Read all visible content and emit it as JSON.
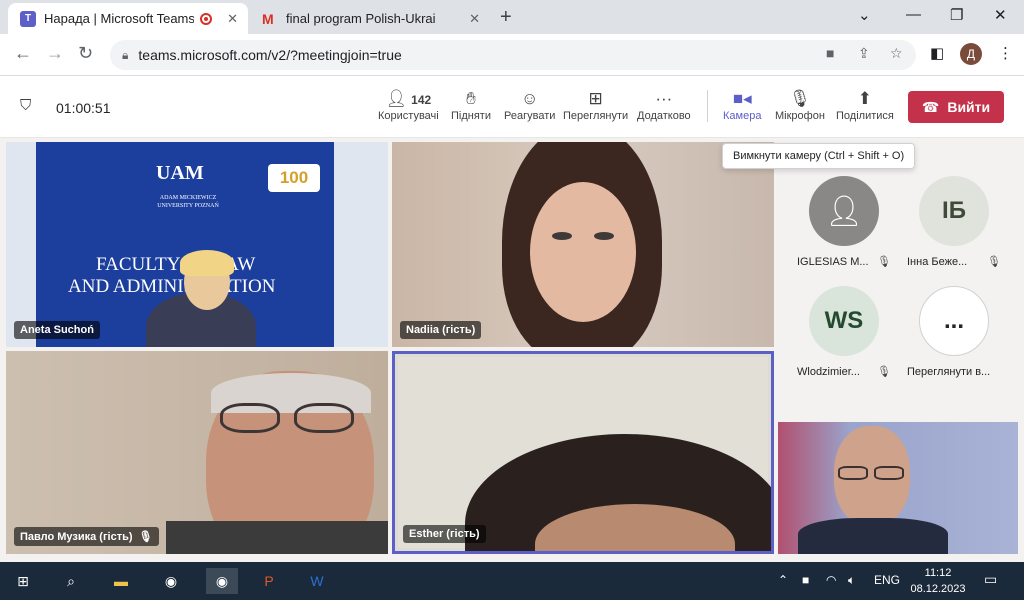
{
  "browser": {
    "tabs": [
      {
        "title": "Нарада | Microsoft Teams",
        "icon": "teams-icon"
      },
      {
        "title": "final program Polish-Ukrainian c",
        "icon": "gmail-icon"
      }
    ],
    "url": "teams.microsoft.com/v2/?meetingjoin=true",
    "profile_initial": "Д"
  },
  "meeting": {
    "timer": "01:00:51",
    "participants_count": "142",
    "tools": [
      {
        "id": "people",
        "label": "Користувачі",
        "icon": "people-icon"
      },
      {
        "id": "raise",
        "label": "Підняти",
        "icon": "raise-hand-icon"
      },
      {
        "id": "react",
        "label": "Реагувати",
        "icon": "smile-icon"
      },
      {
        "id": "view",
        "label": "Переглянути",
        "icon": "grid-icon"
      },
      {
        "id": "more",
        "label": "Додатково",
        "icon": "more-icon"
      },
      {
        "id": "camera",
        "label": "Камера",
        "icon": "camera-icon"
      },
      {
        "id": "mic",
        "label": "Мікрофон",
        "icon": "mic-off-icon"
      },
      {
        "id": "share",
        "label": "Поділитися",
        "icon": "share-icon"
      }
    ],
    "leave_label": "Вийти",
    "tooltip": "Вимкнути камеру (Ctrl + Shift + O)",
    "tiles": [
      {
        "name": "Aneta Suchoń",
        "muted": false
      },
      {
        "name": "Nadiia (гість)",
        "muted": false
      },
      {
        "name": "Павло Музика (гість)",
        "muted": true
      },
      {
        "name": "Esther (гість)",
        "muted": false
      }
    ],
    "sign": {
      "logo": "UAM",
      "university": "ADAM MICKIEWICZ UNIVERSITY POZNAŃ",
      "line1": "FACULTY OF LAW",
      "line2": "AND ADMINISTRATION",
      "badge": "100"
    },
    "side_participants": [
      {
        "name": "IGLESIAS M...",
        "initials": "",
        "muted": true
      },
      {
        "name": "Інна Беже...",
        "initials": "ІБ",
        "muted": true
      },
      {
        "name": "Wlodzimier...",
        "initials": "WS",
        "muted": true
      },
      {
        "name": "Переглянути в...",
        "initials": "...",
        "muted": false
      }
    ]
  },
  "taskbar": {
    "language": "ENG",
    "time": "11:12",
    "date": "08.12.2023"
  }
}
